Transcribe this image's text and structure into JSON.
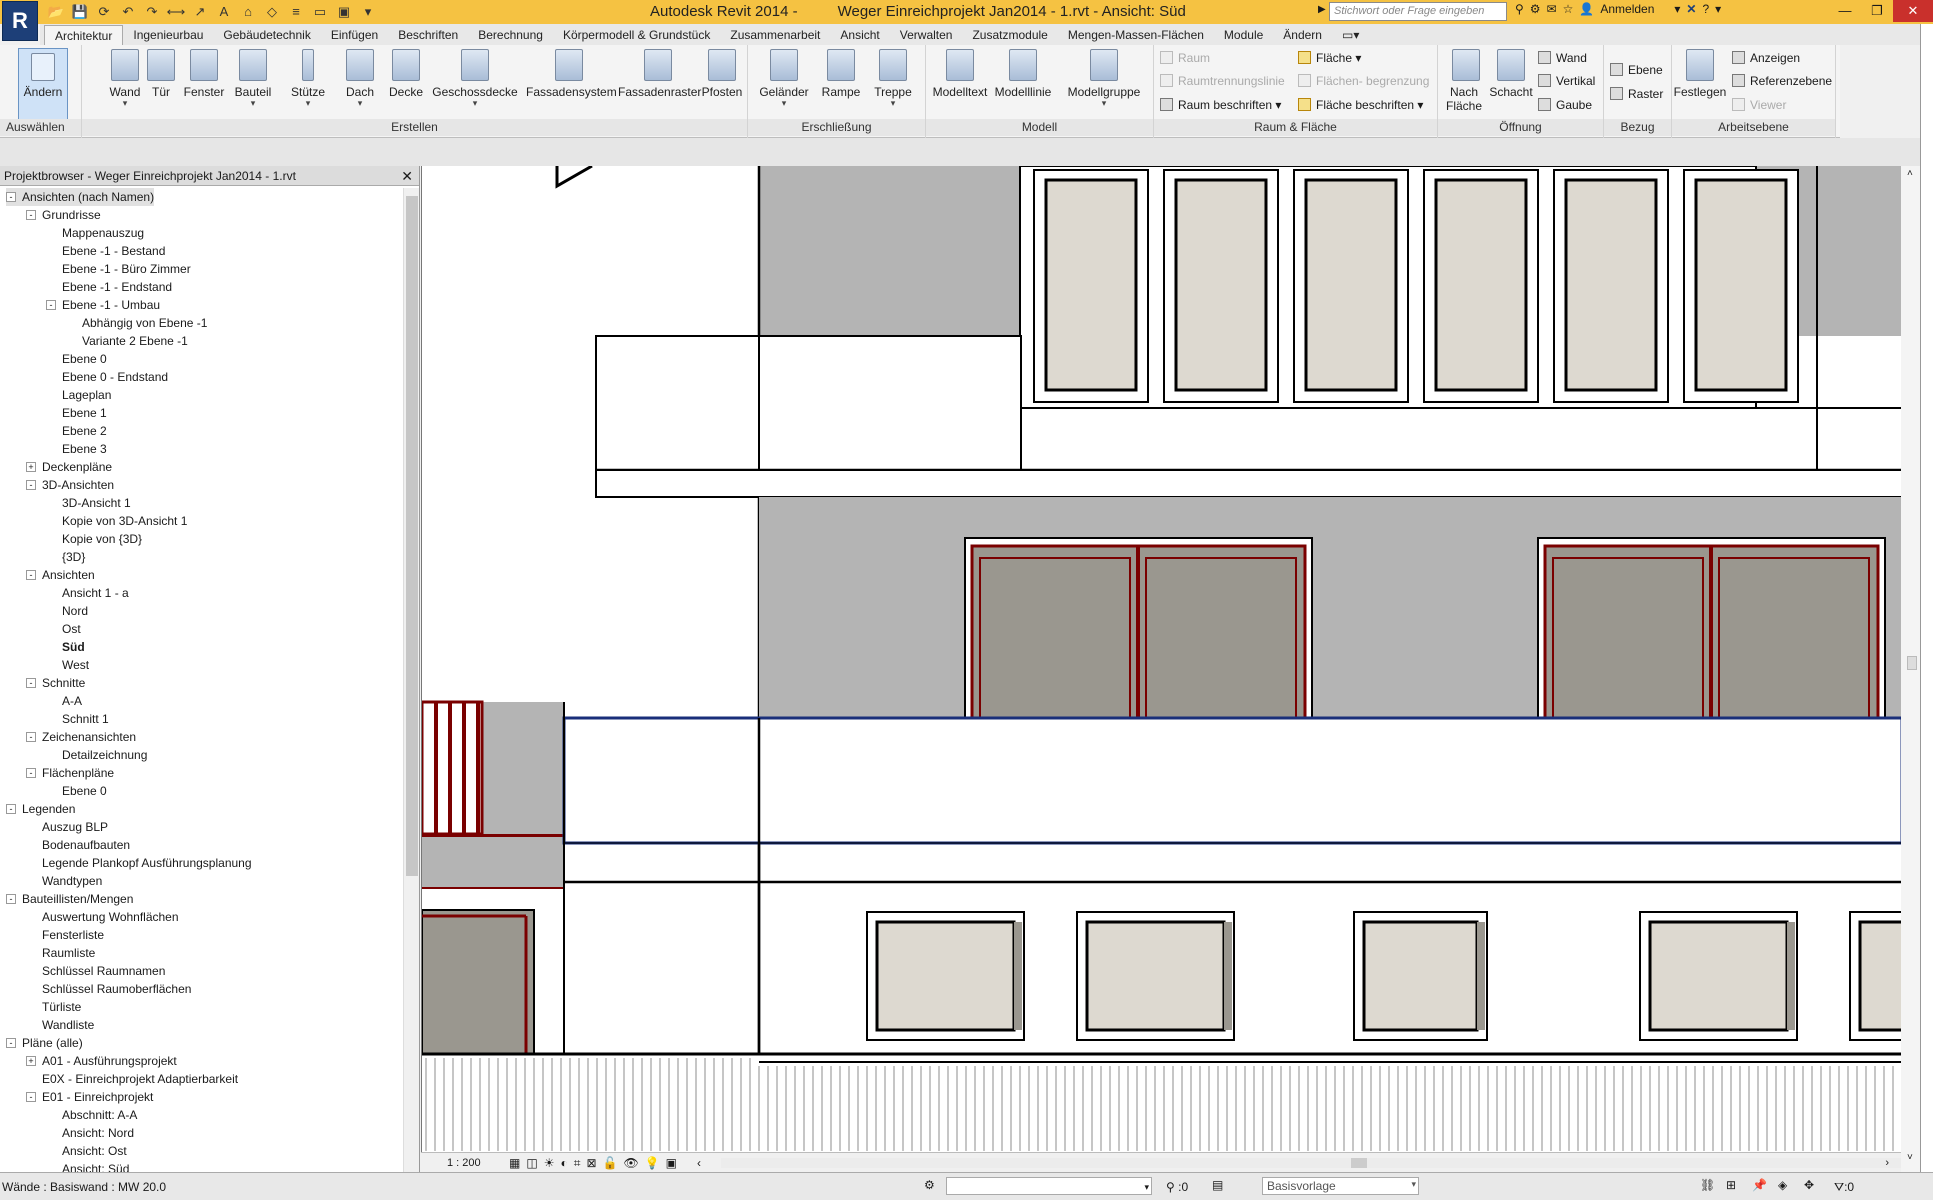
{
  "app": {
    "logo": "R",
    "title_app": "Autodesk Revit 2014 -",
    "title_doc": "Weger Einreichprojekt Jan2014 - 1.rvt - Ansicht: Süd",
    "search_placeholder": "Stichwort oder Frage eingeben",
    "sign_in": "Anmelden"
  },
  "tabs": [
    "Architektur",
    "Ingenieurbau",
    "Gebäudetechnik",
    "Einfügen",
    "Beschriften",
    "Berechnung",
    "Körpermodell & Grundstück",
    "Zusammenarbeit",
    "Ansicht",
    "Verwalten",
    "Zusatzmodule",
    "Mengen-Massen-Flächen",
    "Module",
    "Ändern"
  ],
  "ribbon": {
    "select": {
      "button": "Ändern",
      "label": "Auswählen"
    },
    "create": {
      "label": "Erstellen",
      "buttons": [
        "Wand",
        "Tür",
        "Fenster",
        "Bauteil",
        "Stütze",
        "Dach",
        "Decke",
        "Geschossdecke",
        "Fassadensystem",
        "Fassadenraster",
        "Pfosten"
      ]
    },
    "circulation": {
      "label": "Erschließung",
      "buttons": [
        "Geländer",
        "Rampe",
        "Treppe"
      ]
    },
    "model": {
      "label": "Modell",
      "buttons": [
        "Modelltext",
        "Modelllinie",
        "Modellgruppe"
      ]
    },
    "room_area": {
      "label": "Raum & Fläche",
      "items": [
        "Raum",
        "Raumtrennungslinie",
        "Raum beschriften",
        "Fläche",
        "Flächen- begrenzung",
        "Fläche beschriften"
      ]
    },
    "opening": {
      "label": "Öffnung",
      "big": [
        "Nach Fläche",
        "Schacht"
      ],
      "small": [
        "Wand",
        "Vertikal",
        "Gaube"
      ]
    },
    "datum": {
      "label": "Bezug",
      "items": [
        "Ebene",
        "Raster"
      ]
    },
    "workplane": {
      "label": "Arbeitsebene",
      "big": "Festlegen",
      "small": [
        "Anzeigen",
        "Referenzebene",
        "Viewer"
      ]
    }
  },
  "browser": {
    "title": "Projektbrowser - Weger Einreichprojekt Jan2014 - 1.rvt",
    "tree": [
      {
        "label": "Ansichten (nach Namen)",
        "level": 0,
        "toggle": "-",
        "sel": true
      },
      {
        "label": "Grundrisse",
        "level": 1,
        "toggle": "-"
      },
      {
        "label": "Mappenauszug",
        "level": 2
      },
      {
        "label": "Ebene -1 - Bestand",
        "level": 2
      },
      {
        "label": "Ebene -1 - Büro Zimmer",
        "level": 2
      },
      {
        "label": "Ebene -1 - Endstand",
        "level": 2
      },
      {
        "label": "Ebene -1 - Umbau",
        "level": 2,
        "toggle": "-"
      },
      {
        "label": "Abhängig von Ebene -1",
        "level": 3
      },
      {
        "label": "Variante 2 Ebene -1",
        "level": 3
      },
      {
        "label": "Ebene 0",
        "level": 2
      },
      {
        "label": "Ebene 0 - Endstand",
        "level": 2
      },
      {
        "label": "Lageplan",
        "level": 2
      },
      {
        "label": "Ebene 1",
        "level": 2
      },
      {
        "label": "Ebene 2",
        "level": 2
      },
      {
        "label": "Ebene 3",
        "level": 2
      },
      {
        "label": "Deckenpläne",
        "level": 1,
        "toggle": "+"
      },
      {
        "label": "3D-Ansichten",
        "level": 1,
        "toggle": "-"
      },
      {
        "label": "3D-Ansicht 1",
        "level": 2
      },
      {
        "label": "Kopie von 3D-Ansicht 1",
        "level": 2
      },
      {
        "label": "Kopie von {3D}",
        "level": 2
      },
      {
        "label": "{3D}",
        "level": 2
      },
      {
        "label": "Ansichten",
        "level": 1,
        "toggle": "-"
      },
      {
        "label": "Ansicht 1 - a",
        "level": 2
      },
      {
        "label": "Nord",
        "level": 2
      },
      {
        "label": "Ost",
        "level": 2
      },
      {
        "label": "Süd",
        "level": 2,
        "bold": true
      },
      {
        "label": "West",
        "level": 2
      },
      {
        "label": "Schnitte",
        "level": 1,
        "toggle": "-"
      },
      {
        "label": "A-A",
        "level": 2
      },
      {
        "label": "Schnitt 1",
        "level": 2
      },
      {
        "label": "Zeichenansichten",
        "level": 1,
        "toggle": "-"
      },
      {
        "label": "Detailzeichnung",
        "level": 2
      },
      {
        "label": "Flächenpläne",
        "level": 1,
        "toggle": "-"
      },
      {
        "label": "Ebene 0",
        "level": 2
      },
      {
        "label": "Legenden",
        "level": 0,
        "toggle": "-"
      },
      {
        "label": "Auszug BLP",
        "level": 1
      },
      {
        "label": "Bodenaufbauten",
        "level": 1
      },
      {
        "label": "Legende Plankopf Ausführungsplanung",
        "level": 1
      },
      {
        "label": "Wandtypen",
        "level": 1
      },
      {
        "label": "Bauteillisten/Mengen",
        "level": 0,
        "toggle": "-"
      },
      {
        "label": "Auswertung Wohnflächen",
        "level": 1
      },
      {
        "label": "Fensterliste",
        "level": 1
      },
      {
        "label": "Raumliste",
        "level": 1
      },
      {
        "label": "Schlüssel Raumnamen",
        "level": 1
      },
      {
        "label": "Schlüssel Raumoberflächen",
        "level": 1
      },
      {
        "label": "Türliste",
        "level": 1
      },
      {
        "label": "Wandliste",
        "level": 1
      },
      {
        "label": "Pläne (alle)",
        "level": 0,
        "toggle": "-"
      },
      {
        "label": "A01 - Ausführungsprojekt",
        "level": 1,
        "toggle": "+"
      },
      {
        "label": "E0X - Einreichprojekt Adaptierbarkeit",
        "level": 1
      },
      {
        "label": "E01 - Einreichprojekt",
        "level": 1,
        "toggle": "-"
      },
      {
        "label": "Abschnitt: A-A",
        "level": 2
      },
      {
        "label": "Ansicht: Nord",
        "level": 2
      },
      {
        "label": "Ansicht: Ost",
        "level": 2
      },
      {
        "label": "Ansicht: Süd",
        "level": 2
      }
    ]
  },
  "view": {
    "scale": "1 : 200"
  },
  "status": {
    "text": "Wände : Basiswand : MW 20.0",
    "count": ":0",
    "template": "Basisvorlage",
    "filter": ":0"
  }
}
